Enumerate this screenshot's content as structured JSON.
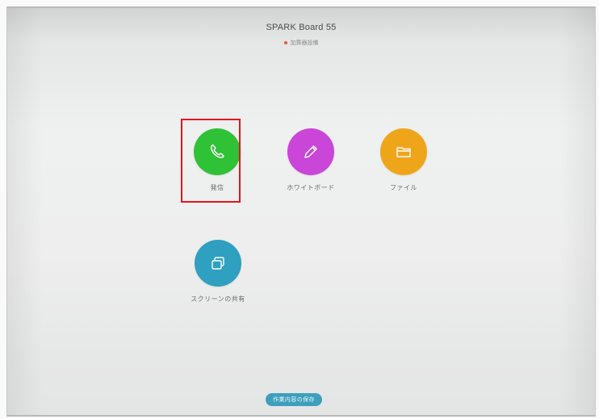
{
  "header": {
    "device_name": "SPARK Board 55",
    "status_text": "加算器設備"
  },
  "apps": [
    {
      "label": "発信",
      "icon": "phone-icon",
      "color": "#2fc136"
    },
    {
      "label": "ホワイトボード",
      "icon": "pencil-icon",
      "color": "#c946d8"
    },
    {
      "label": "ファイル",
      "icon": "folder-icon",
      "color": "#efa51a"
    },
    {
      "label": "スクリーンの共有",
      "icon": "screen-share-icon",
      "color": "#2fa0bf"
    }
  ],
  "bottom_button": {
    "label": "作業内容の保存"
  },
  "colors": {
    "highlight": "#e2161b",
    "status_dot": "#e05a3a",
    "bottom_button_bg": "#3d9fbd"
  }
}
